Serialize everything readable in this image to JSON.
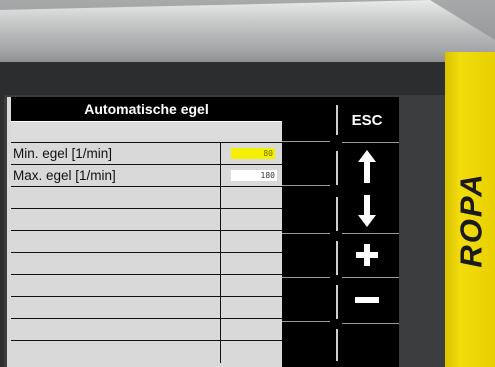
{
  "screen": {
    "title": "Automatische egel",
    "rows": [
      {
        "label": "Min. egel [1/min]",
        "value": "80",
        "value_color": "#f5f000"
      },
      {
        "label": "Max. egel [1/min]",
        "value": "180",
        "value_color": "#ffffff"
      },
      {
        "label": "",
        "value": ""
      },
      {
        "label": "",
        "value": ""
      },
      {
        "label": "",
        "value": ""
      },
      {
        "label": "",
        "value": ""
      },
      {
        "label": "",
        "value": ""
      },
      {
        "label": "",
        "value": ""
      },
      {
        "label": "",
        "value": ""
      },
      {
        "label": "",
        "value": ""
      }
    ]
  },
  "keys": {
    "esc_label": "ESC",
    "up_icon": "arrow-up-icon",
    "down_icon": "arrow-down-icon",
    "plus_icon": "plus-icon",
    "minus_icon": "minus-icon"
  },
  "brand": {
    "name": "ROPA",
    "color": "#f2dc0d"
  }
}
